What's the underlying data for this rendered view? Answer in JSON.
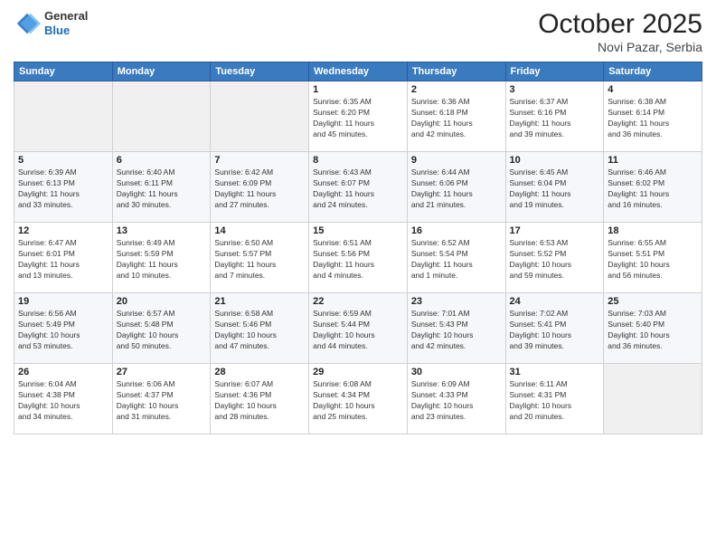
{
  "header": {
    "logo": {
      "general": "General",
      "blue": "Blue"
    },
    "title": "October 2025",
    "location": "Novi Pazar, Serbia"
  },
  "days_of_week": [
    "Sunday",
    "Monday",
    "Tuesday",
    "Wednesday",
    "Thursday",
    "Friday",
    "Saturday"
  ],
  "weeks": [
    [
      {
        "num": "",
        "info": ""
      },
      {
        "num": "",
        "info": ""
      },
      {
        "num": "",
        "info": ""
      },
      {
        "num": "1",
        "info": "Sunrise: 6:35 AM\nSunset: 6:20 PM\nDaylight: 11 hours\nand 45 minutes."
      },
      {
        "num": "2",
        "info": "Sunrise: 6:36 AM\nSunset: 6:18 PM\nDaylight: 11 hours\nand 42 minutes."
      },
      {
        "num": "3",
        "info": "Sunrise: 6:37 AM\nSunset: 6:16 PM\nDaylight: 11 hours\nand 39 minutes."
      },
      {
        "num": "4",
        "info": "Sunrise: 6:38 AM\nSunset: 6:14 PM\nDaylight: 11 hours\nand 36 minutes."
      }
    ],
    [
      {
        "num": "5",
        "info": "Sunrise: 6:39 AM\nSunset: 6:13 PM\nDaylight: 11 hours\nand 33 minutes."
      },
      {
        "num": "6",
        "info": "Sunrise: 6:40 AM\nSunset: 6:11 PM\nDaylight: 11 hours\nand 30 minutes."
      },
      {
        "num": "7",
        "info": "Sunrise: 6:42 AM\nSunset: 6:09 PM\nDaylight: 11 hours\nand 27 minutes."
      },
      {
        "num": "8",
        "info": "Sunrise: 6:43 AM\nSunset: 6:07 PM\nDaylight: 11 hours\nand 24 minutes."
      },
      {
        "num": "9",
        "info": "Sunrise: 6:44 AM\nSunset: 6:06 PM\nDaylight: 11 hours\nand 21 minutes."
      },
      {
        "num": "10",
        "info": "Sunrise: 6:45 AM\nSunset: 6:04 PM\nDaylight: 11 hours\nand 19 minutes."
      },
      {
        "num": "11",
        "info": "Sunrise: 6:46 AM\nSunset: 6:02 PM\nDaylight: 11 hours\nand 16 minutes."
      }
    ],
    [
      {
        "num": "12",
        "info": "Sunrise: 6:47 AM\nSunset: 6:01 PM\nDaylight: 11 hours\nand 13 minutes."
      },
      {
        "num": "13",
        "info": "Sunrise: 6:49 AM\nSunset: 5:59 PM\nDaylight: 11 hours\nand 10 minutes."
      },
      {
        "num": "14",
        "info": "Sunrise: 6:50 AM\nSunset: 5:57 PM\nDaylight: 11 hours\nand 7 minutes."
      },
      {
        "num": "15",
        "info": "Sunrise: 6:51 AM\nSunset: 5:56 PM\nDaylight: 11 hours\nand 4 minutes."
      },
      {
        "num": "16",
        "info": "Sunrise: 6:52 AM\nSunset: 5:54 PM\nDaylight: 11 hours\nand 1 minute."
      },
      {
        "num": "17",
        "info": "Sunrise: 6:53 AM\nSunset: 5:52 PM\nDaylight: 10 hours\nand 59 minutes."
      },
      {
        "num": "18",
        "info": "Sunrise: 6:55 AM\nSunset: 5:51 PM\nDaylight: 10 hours\nand 56 minutes."
      }
    ],
    [
      {
        "num": "19",
        "info": "Sunrise: 6:56 AM\nSunset: 5:49 PM\nDaylight: 10 hours\nand 53 minutes."
      },
      {
        "num": "20",
        "info": "Sunrise: 6:57 AM\nSunset: 5:48 PM\nDaylight: 10 hours\nand 50 minutes."
      },
      {
        "num": "21",
        "info": "Sunrise: 6:58 AM\nSunset: 5:46 PM\nDaylight: 10 hours\nand 47 minutes."
      },
      {
        "num": "22",
        "info": "Sunrise: 6:59 AM\nSunset: 5:44 PM\nDaylight: 10 hours\nand 44 minutes."
      },
      {
        "num": "23",
        "info": "Sunrise: 7:01 AM\nSunset: 5:43 PM\nDaylight: 10 hours\nand 42 minutes."
      },
      {
        "num": "24",
        "info": "Sunrise: 7:02 AM\nSunset: 5:41 PM\nDaylight: 10 hours\nand 39 minutes."
      },
      {
        "num": "25",
        "info": "Sunrise: 7:03 AM\nSunset: 5:40 PM\nDaylight: 10 hours\nand 36 minutes."
      }
    ],
    [
      {
        "num": "26",
        "info": "Sunrise: 6:04 AM\nSunset: 4:38 PM\nDaylight: 10 hours\nand 34 minutes."
      },
      {
        "num": "27",
        "info": "Sunrise: 6:06 AM\nSunset: 4:37 PM\nDaylight: 10 hours\nand 31 minutes."
      },
      {
        "num": "28",
        "info": "Sunrise: 6:07 AM\nSunset: 4:36 PM\nDaylight: 10 hours\nand 28 minutes."
      },
      {
        "num": "29",
        "info": "Sunrise: 6:08 AM\nSunset: 4:34 PM\nDaylight: 10 hours\nand 25 minutes."
      },
      {
        "num": "30",
        "info": "Sunrise: 6:09 AM\nSunset: 4:33 PM\nDaylight: 10 hours\nand 23 minutes."
      },
      {
        "num": "31",
        "info": "Sunrise: 6:11 AM\nSunset: 4:31 PM\nDaylight: 10 hours\nand 20 minutes."
      },
      {
        "num": "",
        "info": ""
      }
    ]
  ]
}
